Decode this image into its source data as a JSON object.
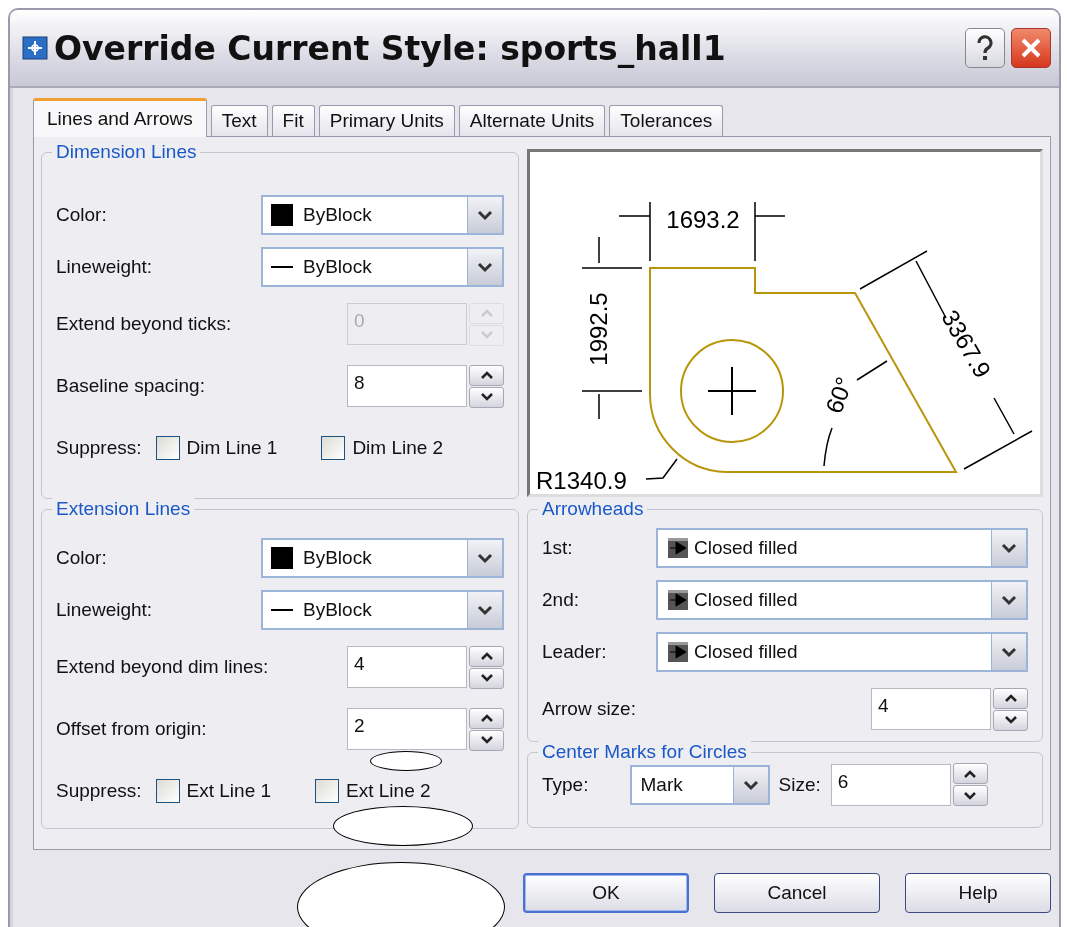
{
  "window": {
    "title": "Override Current Style: sports_hall1"
  },
  "tabs": [
    {
      "label": "Lines and Arrows",
      "selected": true
    },
    {
      "label": "Text",
      "selected": false
    },
    {
      "label": "Fit",
      "selected": false
    },
    {
      "label": "Primary Units",
      "selected": false
    },
    {
      "label": "Alternate Units",
      "selected": false
    },
    {
      "label": "Tolerances",
      "selected": false
    }
  ],
  "dimension_lines": {
    "title": "Dimension Lines",
    "fields": [
      {
        "kind": "color-select",
        "label": "Color:",
        "value": "ByBlock"
      },
      {
        "kind": "lineweight-select",
        "label": "Lineweight:",
        "value": "ByBlock"
      },
      {
        "kind": "spinner",
        "label": "Extend beyond ticks:",
        "value": "0",
        "disabled": true
      },
      {
        "kind": "spinner",
        "label": "Baseline spacing:",
        "value": "8",
        "disabled": false
      }
    ],
    "suppress": {
      "label": "Suppress:",
      "checkboxes": [
        {
          "label": "Dim Line 1",
          "checked": false
        },
        {
          "label": "Dim Line 2",
          "checked": false
        }
      ]
    }
  },
  "extension_lines": {
    "title": "Extension Lines",
    "fields": [
      {
        "kind": "color-select",
        "label": "Color:",
        "value": "ByBlock"
      },
      {
        "kind": "lineweight-select",
        "label": "Lineweight:",
        "value": "ByBlock"
      },
      {
        "kind": "spinner",
        "label": "Extend beyond dim lines:",
        "value": "4",
        "disabled": false
      },
      {
        "kind": "spinner",
        "label": "Offset from origin:",
        "value": "2",
        "disabled": false
      }
    ],
    "suppress": {
      "label": "Suppress:",
      "checkboxes": [
        {
          "label": "Ext Line 1",
          "checked": false
        },
        {
          "label": "Ext Line 2",
          "checked": false
        }
      ]
    }
  },
  "preview": {
    "horizontal_dimension": "1693.2",
    "vertical_dimension": "1992.5",
    "aligned_dimension": "3367.9",
    "angle": "60°",
    "radius": "R1340.9"
  },
  "arrowheads": {
    "title": "Arrowheads",
    "fields": [
      {
        "kind": "arrow-select",
        "label": "1st:",
        "value": "Closed filled"
      },
      {
        "kind": "arrow-select",
        "label": "2nd:",
        "value": "Closed filled"
      },
      {
        "kind": "arrow-select",
        "label": "Leader:",
        "value": "Closed filled"
      },
      {
        "kind": "spinner",
        "label": "Arrow size:",
        "value": "4",
        "disabled": false
      }
    ]
  },
  "center_marks": {
    "title": "Center Marks for Circles",
    "type_label": "Type:",
    "type_value": "Mark",
    "size_label": "Size:",
    "size_value": "6"
  },
  "buttons": [
    {
      "label": "OK",
      "default": true
    },
    {
      "label": "Cancel",
      "default": false
    },
    {
      "label": "Help",
      "default": false
    }
  ]
}
